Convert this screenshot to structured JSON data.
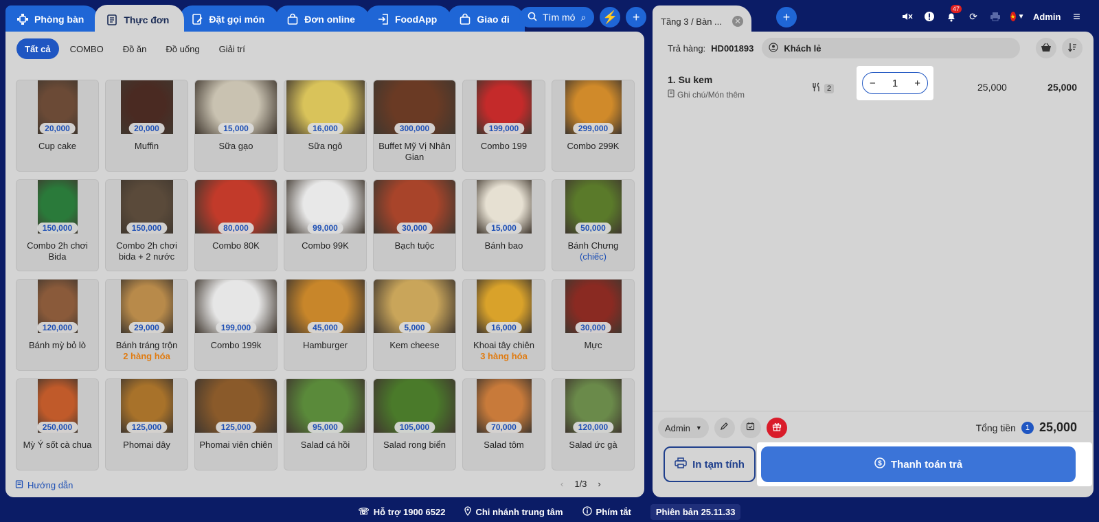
{
  "tabs": [
    {
      "label": "Phòng bàn",
      "icon": "table-icon"
    },
    {
      "label": "Thực đơn",
      "icon": "menu-icon",
      "active": true
    },
    {
      "label": "Đặt gọi món",
      "icon": "order-icon"
    },
    {
      "label": "Đơn online",
      "icon": "bag-icon"
    },
    {
      "label": "FoodApp",
      "icon": "login-icon"
    },
    {
      "label": "Giao đi",
      "icon": "bag-icon"
    }
  ],
  "search": {
    "label": "Tìm mó"
  },
  "categories": [
    "Tất cả",
    "COMBO",
    "Đồ ăn",
    "Đồ uống",
    "Giải trí"
  ],
  "products": [
    {
      "name": "Cup cake",
      "price": "20,000",
      "color": "#6b4a36"
    },
    {
      "name": "Muffin",
      "price": "20,000",
      "color": "#4a2a22"
    },
    {
      "name": "Sữa gạo",
      "price": "15,000",
      "color": "#c9c2b1"
    },
    {
      "name": "Sữa ngô",
      "price": "16,000",
      "color": "#d9c35a"
    },
    {
      "name": "Buffet Mỹ Vị Nhân Gian",
      "price": "300,000",
      "color": "#6a3a24"
    },
    {
      "name": "Combo 199",
      "price": "199,000",
      "color": "#c42a2a"
    },
    {
      "name": "Combo 299K",
      "price": "299,000",
      "color": "#d08a2a"
    },
    {
      "name": "Combo 2h chơi Bida",
      "price": "150,000",
      "color": "#2a7a3a"
    },
    {
      "name": "Combo 2h chơi bida + 2 nước",
      "price": "150,000",
      "color": "#5a4a3a"
    },
    {
      "name": "Combo 80K",
      "price": "80,000",
      "color": "#c23a2a"
    },
    {
      "name": "Combo 99K",
      "price": "99,000",
      "color": "#e8e8e8"
    },
    {
      "name": "Bạch tuộc",
      "price": "30,000",
      "color": "#a8442a"
    },
    {
      "name": "Bánh bao",
      "price": "15,000",
      "color": "#e6e0d2"
    },
    {
      "name": "Bánh Chưng",
      "sub": "(chiếc)",
      "sub_style": "blue",
      "price": "50,000",
      "color": "#5a7a2a"
    },
    {
      "name": "Bánh mỳ bỏ lò",
      "price": "120,000",
      "color": "#8a5a3a"
    },
    {
      "name": "Bánh tráng trộn",
      "sub": "2 hàng hóa",
      "sub_style": "orange",
      "price": "29,000",
      "color": "#b88a4a"
    },
    {
      "name": "Combo 199k",
      "price": "199,000",
      "color": "#e6e6e6"
    },
    {
      "name": "Hamburger",
      "price": "45,000",
      "color": "#c8862a"
    },
    {
      "name": "Kem cheese",
      "price": "5,000",
      "color": "#c9a55a"
    },
    {
      "name": "Khoai tây chiên",
      "sub": "3 hàng hóa",
      "sub_style": "orange",
      "price": "16,000",
      "color": "#d9a22a"
    },
    {
      "name": "Mực",
      "price": "30,000",
      "color": "#8a2a22"
    },
    {
      "name": "Mỳ Ý sốt cà chua",
      "price": "250,000",
      "color": "#c05a2a"
    },
    {
      "name": "Phomai dây",
      "price": "125,000",
      "color": "#a8722a"
    },
    {
      "name": "Phomai viên chiên",
      "price": "125,000",
      "color": "#8a5a2a"
    },
    {
      "name": "Salad cá hồi",
      "price": "95,000",
      "color": "#5a8a3a"
    },
    {
      "name": "Salad rong biển",
      "price": "105,000",
      "color": "#4a7a2a"
    },
    {
      "name": "Salad tôm",
      "price": "70,000",
      "color": "#c87a3a"
    },
    {
      "name": "Salad ức gà",
      "price": "120,000",
      "color": "#6a8a4a"
    }
  ],
  "footer_left": {
    "guide": "Hướng dẫn",
    "page": "1/3"
  },
  "order_tab": {
    "label": "Tầng 3 / Bàn ..."
  },
  "topbar": {
    "badge": "47",
    "user": "Admin"
  },
  "order": {
    "code_label": "Trả hàng:",
    "code": "HD001893",
    "customer": "Khách lẻ",
    "line": {
      "name": "1. Su kem",
      "note": "Ghi chú/Món thêm",
      "kitchen_count": "2",
      "qty": "1",
      "unit_price": "25,000",
      "amount": "25,000"
    },
    "staff": "Admin",
    "total_label": "Tổng tiền",
    "total_count": "1",
    "total": "25,000",
    "print_label": "In tạm tính",
    "pay_label": "Thanh toán trả"
  },
  "status": {
    "support": "Hỗ trợ 1900 6522",
    "branch": "Chi nhánh trung tâm",
    "shortcut": "Phím tắt",
    "version": "Phiên bản 25.11.33"
  }
}
